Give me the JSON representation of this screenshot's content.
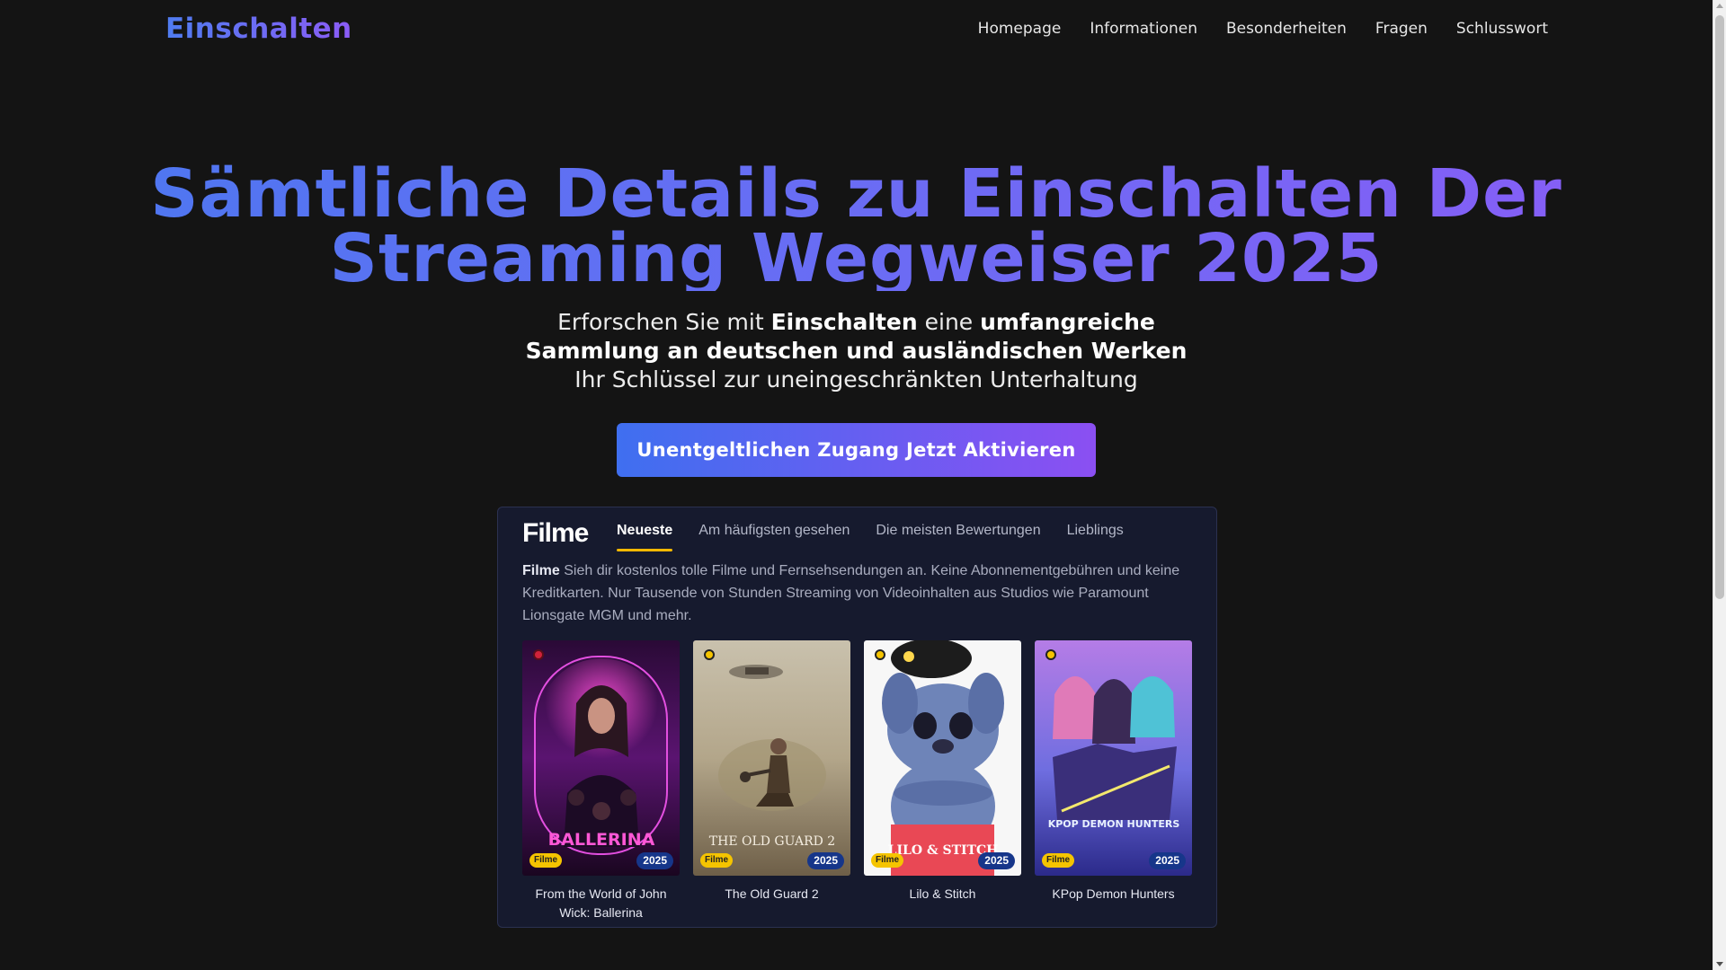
{
  "header": {
    "logo": "Einschalten",
    "nav": [
      "Homepage",
      "Informationen",
      "Besonderheiten",
      "Fragen",
      "Schlusswort"
    ]
  },
  "hero": {
    "title_line1": "Sämtliche Details zu Einschalten Der",
    "title_line2": "Streaming Wegweiser 2025",
    "sub_1": "Erforschen Sie mit ",
    "sub_2": "Einschalten",
    "sub_3": " eine ",
    "sub_4": "umfangreiche Sammlung an deutschen und ausländischen Werken",
    "sub_5": " Ihr Schlüssel zur uneingeschränkten Unterhaltung",
    "cta": "Unentgeltlichen Zugang Jetzt Aktivieren"
  },
  "panel": {
    "title": "Filme",
    "tabs": [
      "Neueste",
      "Am häufigsten gesehen",
      "Die meisten Bewertungen",
      "Lieblings"
    ],
    "desc_bold": "Filme",
    "desc": " Sieh dir kostenlos tolle Filme und Fernsehsendungen an. Keine Abonnementgebühren und keine Kreditkarten. Nur Tausende von Stunden Streaming von Videoinhalten aus Studios wie Paramount Lionsgate MGM und mehr.",
    "cards": [
      {
        "title": "From the World of John Wick: Ballerina",
        "badge": "Filme",
        "year": "2025",
        "poster_text": "BALLERINA"
      },
      {
        "title": "The Old Guard 2",
        "badge": "Filme",
        "year": "2025",
        "poster_text": "THE OLD GUARD 2"
      },
      {
        "title": "Lilo & Stitch",
        "badge": "Filme",
        "year": "2025",
        "poster_text": "LILO & STITCH"
      },
      {
        "title": "KPop Demon Hunters",
        "badge": "Filme",
        "year": "2025",
        "poster_text": "KPOP DEMON HUNTERS"
      }
    ]
  },
  "colors": {
    "background": "#141414",
    "accent_blue": "#4a78f0",
    "accent_purple": "#8b5cf6",
    "tab_underline": "#f5b800",
    "badge_yellow": "#f5c400",
    "badge_blue": "#16368a"
  }
}
